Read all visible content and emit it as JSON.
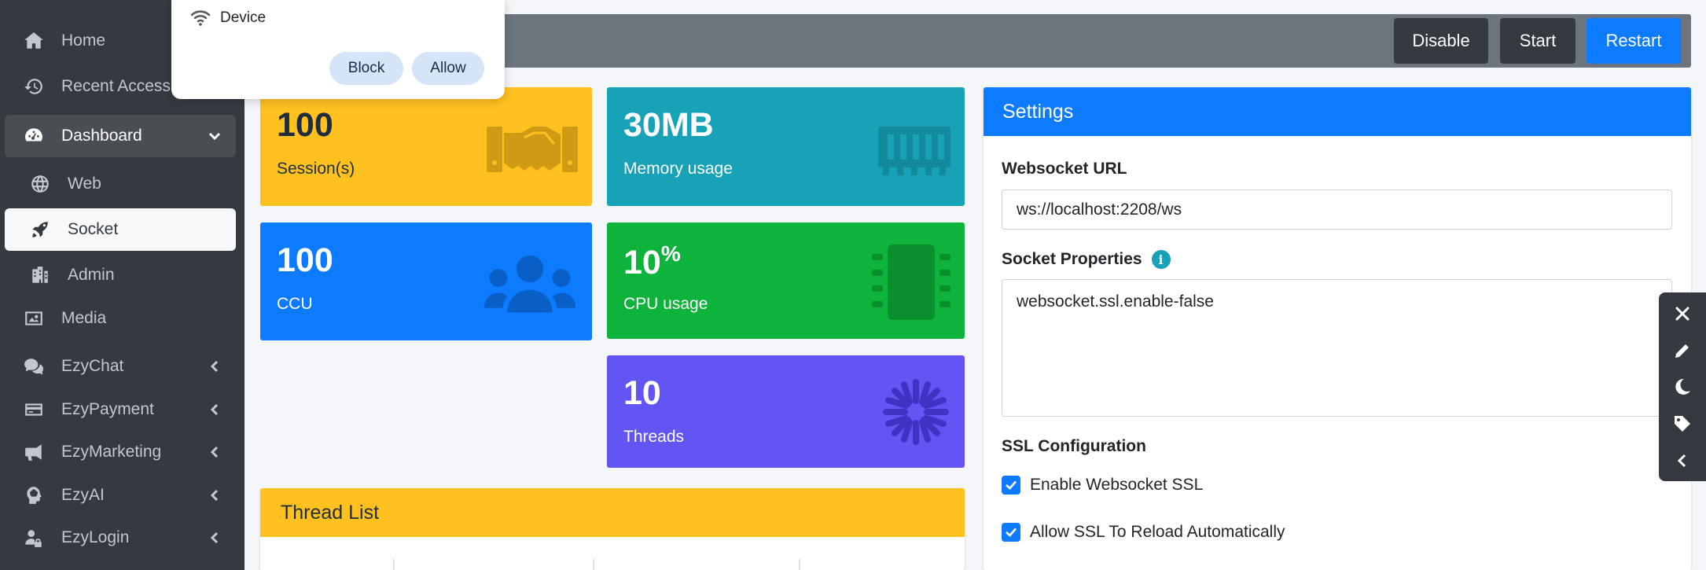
{
  "sidebar": {
    "items": [
      {
        "label": "Home",
        "icon": "home-icon"
      },
      {
        "label": "Recent Access",
        "icon": "history-icon"
      },
      {
        "label": "Dashboard",
        "icon": "dashboard-icon"
      },
      {
        "label": "Web",
        "icon": "globe-icon"
      },
      {
        "label": "Socket",
        "icon": "rocket-icon"
      },
      {
        "label": "Admin",
        "icon": "building-icon"
      },
      {
        "label": "Media",
        "icon": "image-icon"
      },
      {
        "label": "EzyChat",
        "icon": "chat-icon"
      },
      {
        "label": "EzyPayment",
        "icon": "credit-card-icon"
      },
      {
        "label": "EzyMarketing",
        "icon": "megaphone-icon"
      },
      {
        "label": "EzyAI",
        "icon": "brain-icon"
      },
      {
        "label": "EzyLogin",
        "icon": "user-lock-icon"
      }
    ]
  },
  "toolbar": {
    "disable_label": "Disable",
    "start_label": "Start",
    "restart_label": "Restart"
  },
  "popup": {
    "device_label": "Device",
    "block_label": "Block",
    "allow_label": "Allow"
  },
  "stats": {
    "sessions": {
      "value": "100",
      "label": "Session(s)"
    },
    "memory": {
      "value": "30MB",
      "label": "Memory usage"
    },
    "ccu": {
      "value": "100",
      "label": "CCU"
    },
    "cpu": {
      "value": "10",
      "unit": "%",
      "label": "CPU usage"
    },
    "threads": {
      "value": "10",
      "label": "Threads"
    }
  },
  "thread_list": {
    "title": "Thread List"
  },
  "settings": {
    "title": "Settings",
    "websocket_url_label": "Websocket URL",
    "websocket_url_value": "ws://localhost:2208/ws",
    "socket_properties_label": "Socket Properties",
    "socket_properties_value": "websocket.ssl.enable-false",
    "ssl_config_label": "SSL Configuration",
    "enable_ssl_label": "Enable Websocket SSL",
    "enable_ssl_checked": true,
    "allow_reload_label": "Allow SSL To Reload Automatically",
    "allow_reload_checked": true
  },
  "colors": {
    "sidebar": "#343a40",
    "primary": "#0d7bff",
    "warning": "#ffc120",
    "info": "#17a2b8",
    "success": "#0db33a",
    "purple": "#6355f4"
  }
}
